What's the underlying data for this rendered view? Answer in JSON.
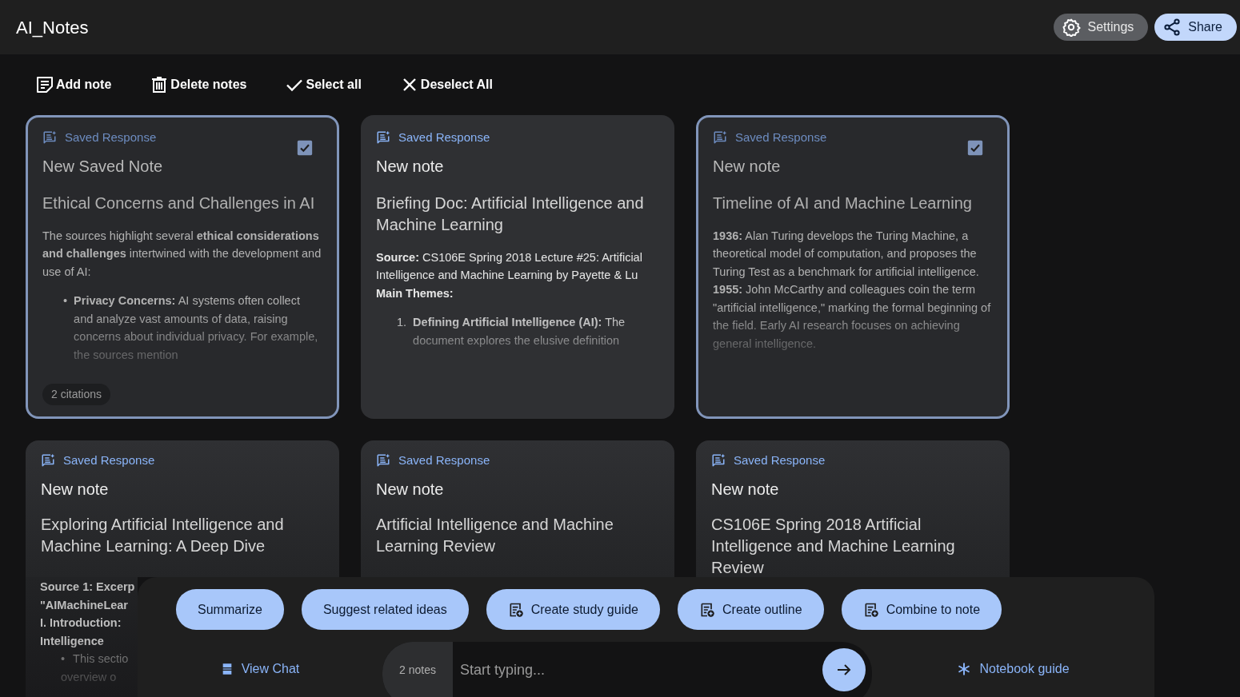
{
  "app": {
    "title": "AI_Notes"
  },
  "header_buttons": [
    {
      "kind": "settings",
      "label": "Settings"
    },
    {
      "kind": "share",
      "label": "Share"
    }
  ],
  "toolbar": [
    {
      "kind": "add",
      "label": "Add note"
    },
    {
      "kind": "delete",
      "label": "Delete notes"
    },
    {
      "kind": "select",
      "label": "Select all"
    },
    {
      "kind": "deselect",
      "label": "Deselect All"
    }
  ],
  "notes": [
    {
      "badge": "Saved Response",
      "title": "New Saved Note",
      "heading": "Ethical Concerns and Challenges in AI",
      "selected": true,
      "citations": "2 citations",
      "body": [
        {
          "kind": "para",
          "text": "The sources highlight several **ethical considerations and challenges** intertwined with the development and use of AI:"
        },
        {
          "kind": "list",
          "marker": "•",
          "text": "**Privacy Concerns:** AI systems often collect and analyze vast amounts of data, raising concerns about individual privacy. For example, the sources mention"
        }
      ]
    },
    {
      "badge": "Saved Response",
      "title": "New note",
      "heading": "Briefing Doc: Artificial Intelligence and Machine Learning",
      "selected": false,
      "body": [
        {
          "kind": "para",
          "text": "**Source:** CS106E Spring 2018 Lecture #25: Artificial Intelligence and Machine Learning by Payette & Lu"
        },
        {
          "kind": "label",
          "text": "Main Themes:"
        },
        {
          "kind": "list",
          "marker": "1.",
          "text": "**Defining Artificial Intelligence (AI):** The document explores the elusive definition"
        }
      ]
    },
    {
      "badge": "Saved Response",
      "title": "New note",
      "heading": "Timeline of AI and Machine Learning",
      "selected": true,
      "body": [
        {
          "kind": "para",
          "text": "**1936:** Alan Turing develops the Turing Machine, a theoretical model of computation, and proposes the Turing Test as a benchmark for artificial intelligence."
        },
        {
          "kind": "para",
          "text": "**1955:** John McCarthy and colleagues coin the term \"artificial intelligence,\" marking the formal beginning of the field. Early AI research focuses on achieving general intelligence."
        }
      ]
    },
    {
      "badge": "Saved Response",
      "title": "New note",
      "heading": "Exploring Artificial Intelligence and Machine Learning: A Deep Dive",
      "selected": false,
      "body": [
        {
          "kind": "fragment",
          "text": "Source 1: Excerp"
        },
        {
          "kind": "fragment",
          "text": "\"AIMachineLear"
        },
        {
          "kind": "fragment",
          "text": "I. Introduction:"
        },
        {
          "kind": "fragment",
          "text": "Intelligence"
        },
        {
          "kind": "list-fragment",
          "marker": "•",
          "text": "This sectio"
        },
        {
          "kind": "list-fragment",
          "text": "overview o"
        }
      ]
    },
    {
      "badge": "Saved Response",
      "title": "New note",
      "heading": "Artificial Intelligence and Machine Learning Review",
      "selected": false
    },
    {
      "badge": "Saved Response",
      "title": "New note",
      "heading": "CS106E Spring 2018 Artificial Intelligence and Machine Learning Review",
      "selected": false
    }
  ],
  "actions": [
    {
      "kind": "plain",
      "label": "Summarize"
    },
    {
      "kind": "plain",
      "label": "Suggest related ideas"
    },
    {
      "kind": "doc",
      "label": "Create study guide"
    },
    {
      "kind": "doc",
      "label": "Create outline"
    },
    {
      "kind": "doc",
      "label": "Combine to note"
    }
  ],
  "view_chat": "View Chat",
  "composer": {
    "count": "2 notes",
    "placeholder": "Start typing..."
  },
  "notebook_guide": "Notebook guide"
}
